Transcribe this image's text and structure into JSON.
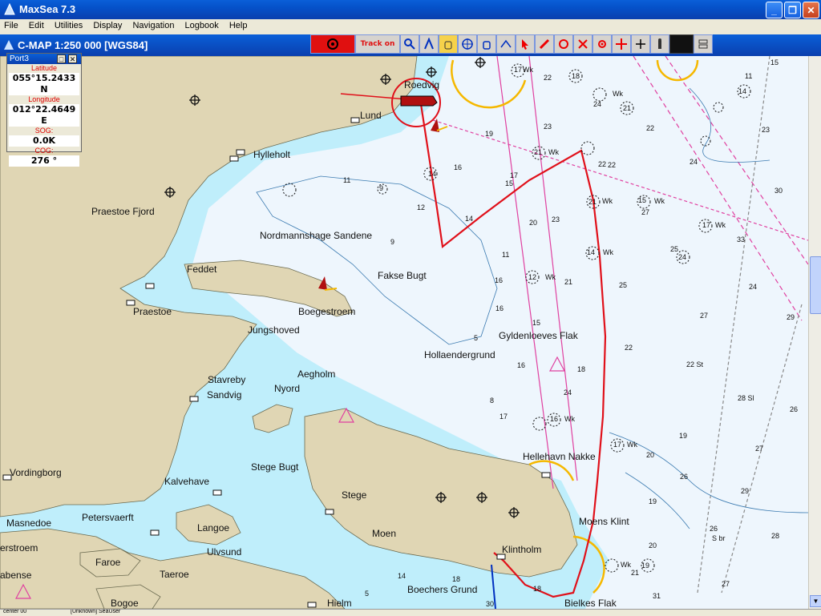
{
  "window": {
    "title": "MaxSea 7.3",
    "minimize": "_",
    "maximize": "❐",
    "close": "✕"
  },
  "menu": [
    "File",
    "Edit",
    "Utilities",
    "Display",
    "Navigation",
    "Logbook",
    "Help"
  ],
  "chart_header": "C-MAP  1:250 000 [WGS84]",
  "toolbar": {
    "track_label": "Track on",
    "icons": [
      "magnifier-icon",
      "compass-divider-icon",
      "hand-icon",
      "target-icon",
      "pan-hand-icon",
      "route-icon",
      "pointer-icon",
      "pencil-icon",
      "undo-circle-icon",
      "scissors-icon",
      "waypoint-icon",
      "move-icon",
      "plus-icon",
      "lighthouse-icon"
    ]
  },
  "port3": {
    "title": "Port3",
    "latitude_label": "Latitude",
    "latitude": "055°15.2433 N",
    "longitude_label": "Longitude",
    "longitude": "012°22.4649 E",
    "sog_label": "SOG:",
    "sog": "0.0K",
    "cog_label": "COG:",
    "cog": "276 °"
  },
  "places": [
    {
      "name": "Roedvig"
    },
    {
      "name": "Lund"
    },
    {
      "name": "Hylleholt"
    },
    {
      "name": "Praestoe Fjord"
    },
    {
      "name": "Nordmannshage Sandene"
    },
    {
      "name": "Fakse Bugt"
    },
    {
      "name": "Feddet"
    },
    {
      "name": "Praestoe"
    },
    {
      "name": "Boegestroem"
    },
    {
      "name": "Jungshoved"
    },
    {
      "name": "Gyldenloeves Flak"
    },
    {
      "name": "Hollaendergrund"
    },
    {
      "name": "Aegholm"
    },
    {
      "name": "Stavreby"
    },
    {
      "name": "Nyord"
    },
    {
      "name": "Sandvig"
    },
    {
      "name": "Hellehavn Nakke"
    },
    {
      "name": "Vordingborg"
    },
    {
      "name": "Stege Bugt"
    },
    {
      "name": "Kalvehave"
    },
    {
      "name": "Stege"
    },
    {
      "name": "Petersvaerft"
    },
    {
      "name": "Masnedoe"
    },
    {
      "name": "Langoe"
    },
    {
      "name": "Moen"
    },
    {
      "name": "Moens Klint"
    },
    {
      "name": "erstroem"
    },
    {
      "name": "Ulvsund"
    },
    {
      "name": "Faroe"
    },
    {
      "name": "Klintholm"
    },
    {
      "name": "abense"
    },
    {
      "name": "Taeroe"
    },
    {
      "name": "Boechers Grund"
    },
    {
      "name": "Bogoe"
    },
    {
      "name": "Hielm"
    },
    {
      "name": "Bielkes Flak"
    }
  ],
  "depths": [
    {
      "t": "17"
    },
    {
      "t": "22"
    },
    {
      "t": "11"
    },
    {
      "t": "15"
    },
    {
      "t": "18"
    },
    {
      "t": "24"
    },
    {
      "t": "21"
    },
    {
      "t": "22"
    },
    {
      "t": "14"
    },
    {
      "t": "23"
    },
    {
      "t": "19"
    },
    {
      "t": "21"
    },
    {
      "t": "22"
    },
    {
      "t": "14"
    },
    {
      "t": "11"
    },
    {
      "t": "16"
    },
    {
      "t": "15"
    },
    {
      "t": "17"
    },
    {
      "t": "9"
    },
    {
      "t": "12"
    },
    {
      "t": "14"
    },
    {
      "t": "23"
    },
    {
      "t": "21"
    },
    {
      "t": "15"
    },
    {
      "t": "27"
    },
    {
      "t": "17"
    },
    {
      "t": "33"
    },
    {
      "t": "25"
    },
    {
      "t": "24"
    },
    {
      "t": "11"
    },
    {
      "t": "14"
    },
    {
      "t": "16"
    },
    {
      "t": "12"
    },
    {
      "t": "21"
    },
    {
      "t": "25"
    },
    {
      "t": "16"
    },
    {
      "t": "24"
    },
    {
      "t": "9"
    },
    {
      "t": "27"
    },
    {
      "t": "29"
    },
    {
      "t": "15"
    },
    {
      "t": "5"
    },
    {
      "t": "22"
    },
    {
      "t": "16"
    },
    {
      "t": "18"
    },
    {
      "t": "22 St"
    },
    {
      "t": "28 Sl"
    },
    {
      "t": "24"
    },
    {
      "t": "17"
    },
    {
      "t": "16"
    },
    {
      "t": "26"
    },
    {
      "t": "17"
    },
    {
      "t": "19"
    },
    {
      "t": "27"
    },
    {
      "t": "20"
    },
    {
      "t": "26"
    },
    {
      "t": "29"
    },
    {
      "t": "19"
    },
    {
      "t": "26"
    },
    {
      "t": "28"
    },
    {
      "t": "S br"
    },
    {
      "t": "20"
    },
    {
      "t": "19"
    },
    {
      "t": "21"
    },
    {
      "t": "18"
    },
    {
      "t": "27"
    },
    {
      "t": "14"
    },
    {
      "t": "18"
    },
    {
      "t": "31"
    },
    {
      "t": "5"
    },
    {
      "t": "30"
    },
    {
      "t": "23"
    },
    {
      "t": "24"
    },
    {
      "t": "30"
    },
    {
      "t": "8"
    },
    {
      "t": "22"
    },
    {
      "t": "20"
    }
  ],
  "wk_label": "Wk",
  "statusbar": {
    "left": "center 00",
    "user": "[Unknown] SeaUser"
  },
  "colors": {
    "sea_shallow": "#bfeefb",
    "sea_deep": "#eef6fd",
    "land": "#e0d6b4",
    "track": "#e0101a",
    "boundary": "#e040a0"
  }
}
